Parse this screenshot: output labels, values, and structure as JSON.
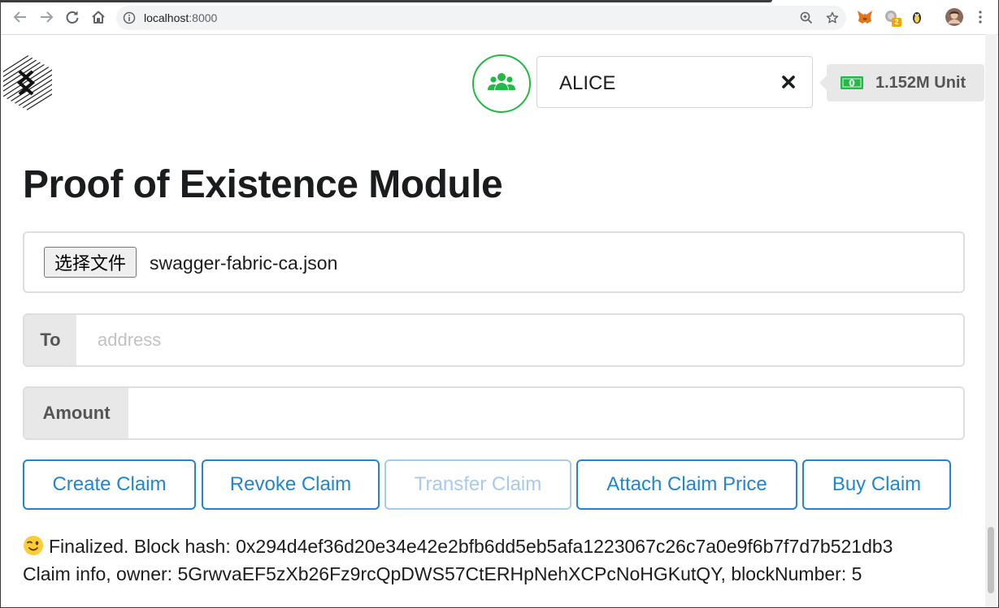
{
  "browser": {
    "url_host": "localhost",
    "url_port": ":8000",
    "extension_badge": "2"
  },
  "header": {
    "account_name": "ALICE",
    "balance": "1.152M Unit"
  },
  "page_title": "Proof of Existence Module",
  "file_input": {
    "button_label": "选择文件",
    "file_name": "swagger-fabric-ca.json"
  },
  "to_field": {
    "label": "To",
    "placeholder": "address",
    "value": ""
  },
  "amount_field": {
    "label": "Amount",
    "value": ""
  },
  "buttons": {
    "create": "Create Claim",
    "revoke": "Revoke Claim",
    "transfer": "Transfer Claim",
    "attach_price": "Attach Claim Price",
    "buy": "Buy Claim"
  },
  "status": {
    "emoji": "wink-emoji",
    "line1": "Finalized. Block hash: 0x294d4ef36d20e34e42e2bfb6dd5eb5afa1223067c26c7a0e9f6b7f7d7b521db3",
    "line2": "Claim info, owner: 5GrwvaEF5zXb26Fz9rcQpDWS57CtERHpNehXCPcNoHGKutQY, blockNumber: 5"
  },
  "colors": {
    "primary": "#2185d0",
    "primary_disabled": "#a7cbe9",
    "account_green": "#21ba45",
    "money_green": "#21ba45"
  }
}
